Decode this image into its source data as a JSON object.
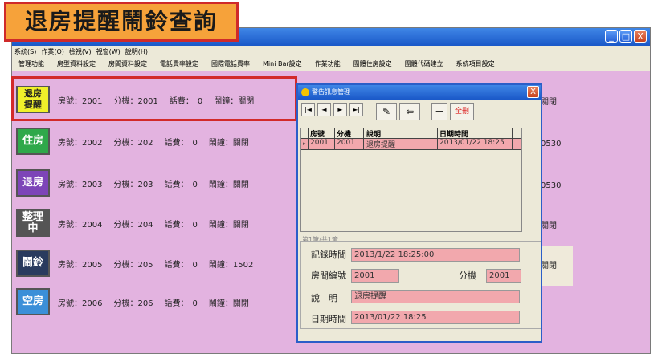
{
  "banner": {
    "title": "退房提醒鬧鈴查詢"
  },
  "window": {
    "min": "_",
    "max": "□",
    "close": "X"
  },
  "menu": [
    "系統(S)",
    "作業(O)",
    "檢視(V)",
    "視窗(W)",
    "說明(H)"
  ],
  "toolbar": [
    "管理功能",
    "房型資料設定",
    "房間資料設定",
    "電話費率設定",
    "國際電話費率",
    "Mini Bar設定",
    "作業功能",
    "團體住房設定",
    "團體代碼建立",
    "系統項目設定"
  ],
  "rooms": [
    {
      "status": "退房提醒",
      "status_color": "#f0f02a",
      "status_text_color": "#222",
      "room": "房號：2001",
      "ext": "分機：2001",
      "fee": "話費：　0",
      "alarm": "鬧鐘：關閉",
      "right": "：關閉"
    },
    {
      "status": "住房",
      "status_color": "#2fa84a",
      "status_text_color": "#fff",
      "room": "房號：2002",
      "ext": "分機：202",
      "fee": "話費：　0",
      "alarm": "鬧鐘：關閉",
      "right": "：0530"
    },
    {
      "status": "退房",
      "status_color": "#7d45b8",
      "status_text_color": "#fff",
      "room": "房號：2003",
      "ext": "分機：203",
      "fee": "話費：　0",
      "alarm": "鬧鐘：關閉",
      "right": "：0530"
    },
    {
      "status": "整理中",
      "status_color": "#555555",
      "status_text_color": "#fff",
      "room": "房號：2004",
      "ext": "分機：204",
      "fee": "話費：　0",
      "alarm": "鬧鐘：關閉",
      "right": "：關閉"
    },
    {
      "status": "鬧鈴",
      "status_color": "#2a3b5e",
      "status_text_color": "#fff",
      "room": "房號：2005",
      "ext": "分機：205",
      "fee": "話費：　0",
      "alarm": "鬧鐘：1502",
      "right": "：關閉"
    },
    {
      "status": "空房",
      "status_color": "#3b8fd8",
      "status_text_color": "#fff",
      "room": "房號：2006",
      "ext": "分機：206",
      "fee": "話費：　0",
      "alarm": "鬧鐘：關閉",
      "right": ""
    }
  ],
  "dialog": {
    "title": "警告訊息管理",
    "close": "X",
    "nav": [
      "|◄",
      "◄",
      "►",
      "►|"
    ],
    "tools": [
      "✎",
      "⇦",
      "－"
    ],
    "delete_label": "全刪",
    "headers": [
      "房號",
      "分機",
      "說明",
      "日期時間"
    ],
    "row": {
      "marker": "▸",
      "room": "2001",
      "ext": "2001",
      "desc": "退房提醒",
      "datetime": "2013/01/22 18:25"
    },
    "record_counter": "第1筆/共1筆",
    "fields": {
      "record_time_label": "記錄時間",
      "record_time": "2013/1/22 18:25:00",
      "room_label": "房間編號",
      "room": "2001",
      "ext_label": "分機",
      "ext": "2001",
      "desc_label": "說　明",
      "desc": "退房提醒",
      "date_label": "日期時間",
      "date": "2013/01/22 18:25"
    }
  }
}
